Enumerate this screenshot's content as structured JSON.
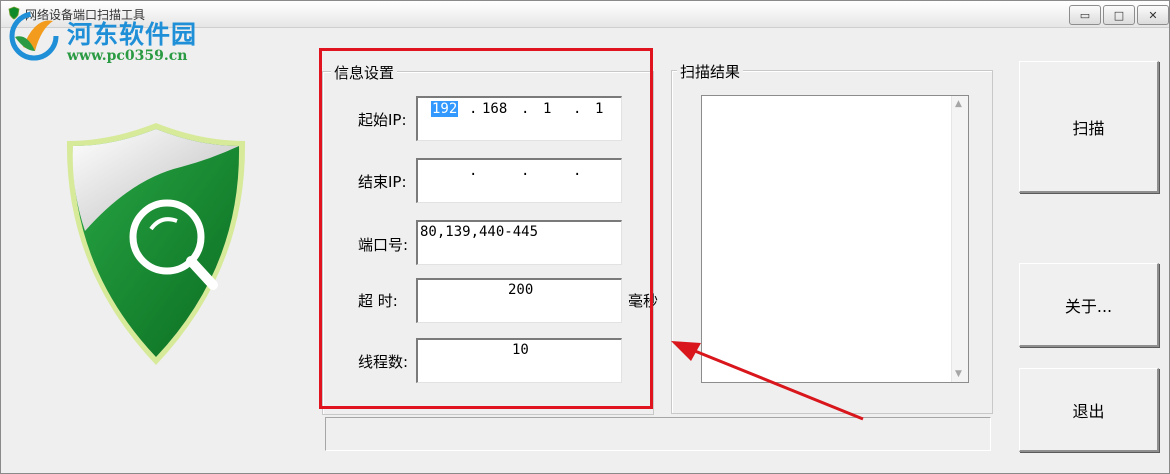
{
  "window": {
    "title": "网络设备端口扫描工具",
    "controls": {
      "minimize": "▭",
      "maximize": "□",
      "close": "✕"
    }
  },
  "watermark": {
    "title": "河东软件园",
    "url": "www.pc0359.cn"
  },
  "info_group": {
    "legend": "信息设置",
    "fields": {
      "start_ip": {
        "label": "起始IP:",
        "octets": [
          "192",
          "168",
          "1",
          "1"
        ],
        "selected_octet": 0
      },
      "end_ip": {
        "label": "结束IP:",
        "octets": [
          "",
          "",
          "",
          ""
        ],
        "dots": "."
      },
      "port": {
        "label": "端口号:",
        "value": "80,139,440-445"
      },
      "timeout": {
        "label": "超  时:",
        "value": "200",
        "unit": "毫秒"
      },
      "threads": {
        "label": "线程数:",
        "value": "10"
      }
    },
    "highlight_color": "#e0141e"
  },
  "result_group": {
    "legend": "扫描结果",
    "items": []
  },
  "buttons": {
    "scan": "扫描",
    "about": "关于...",
    "exit": "退出"
  },
  "status": {
    "text": ""
  },
  "colors": {
    "shield_green": "#0e8a2a",
    "watermark_blue": "#1f8fd8",
    "watermark_green": "#2a9a43",
    "selection": "#3399ff"
  }
}
